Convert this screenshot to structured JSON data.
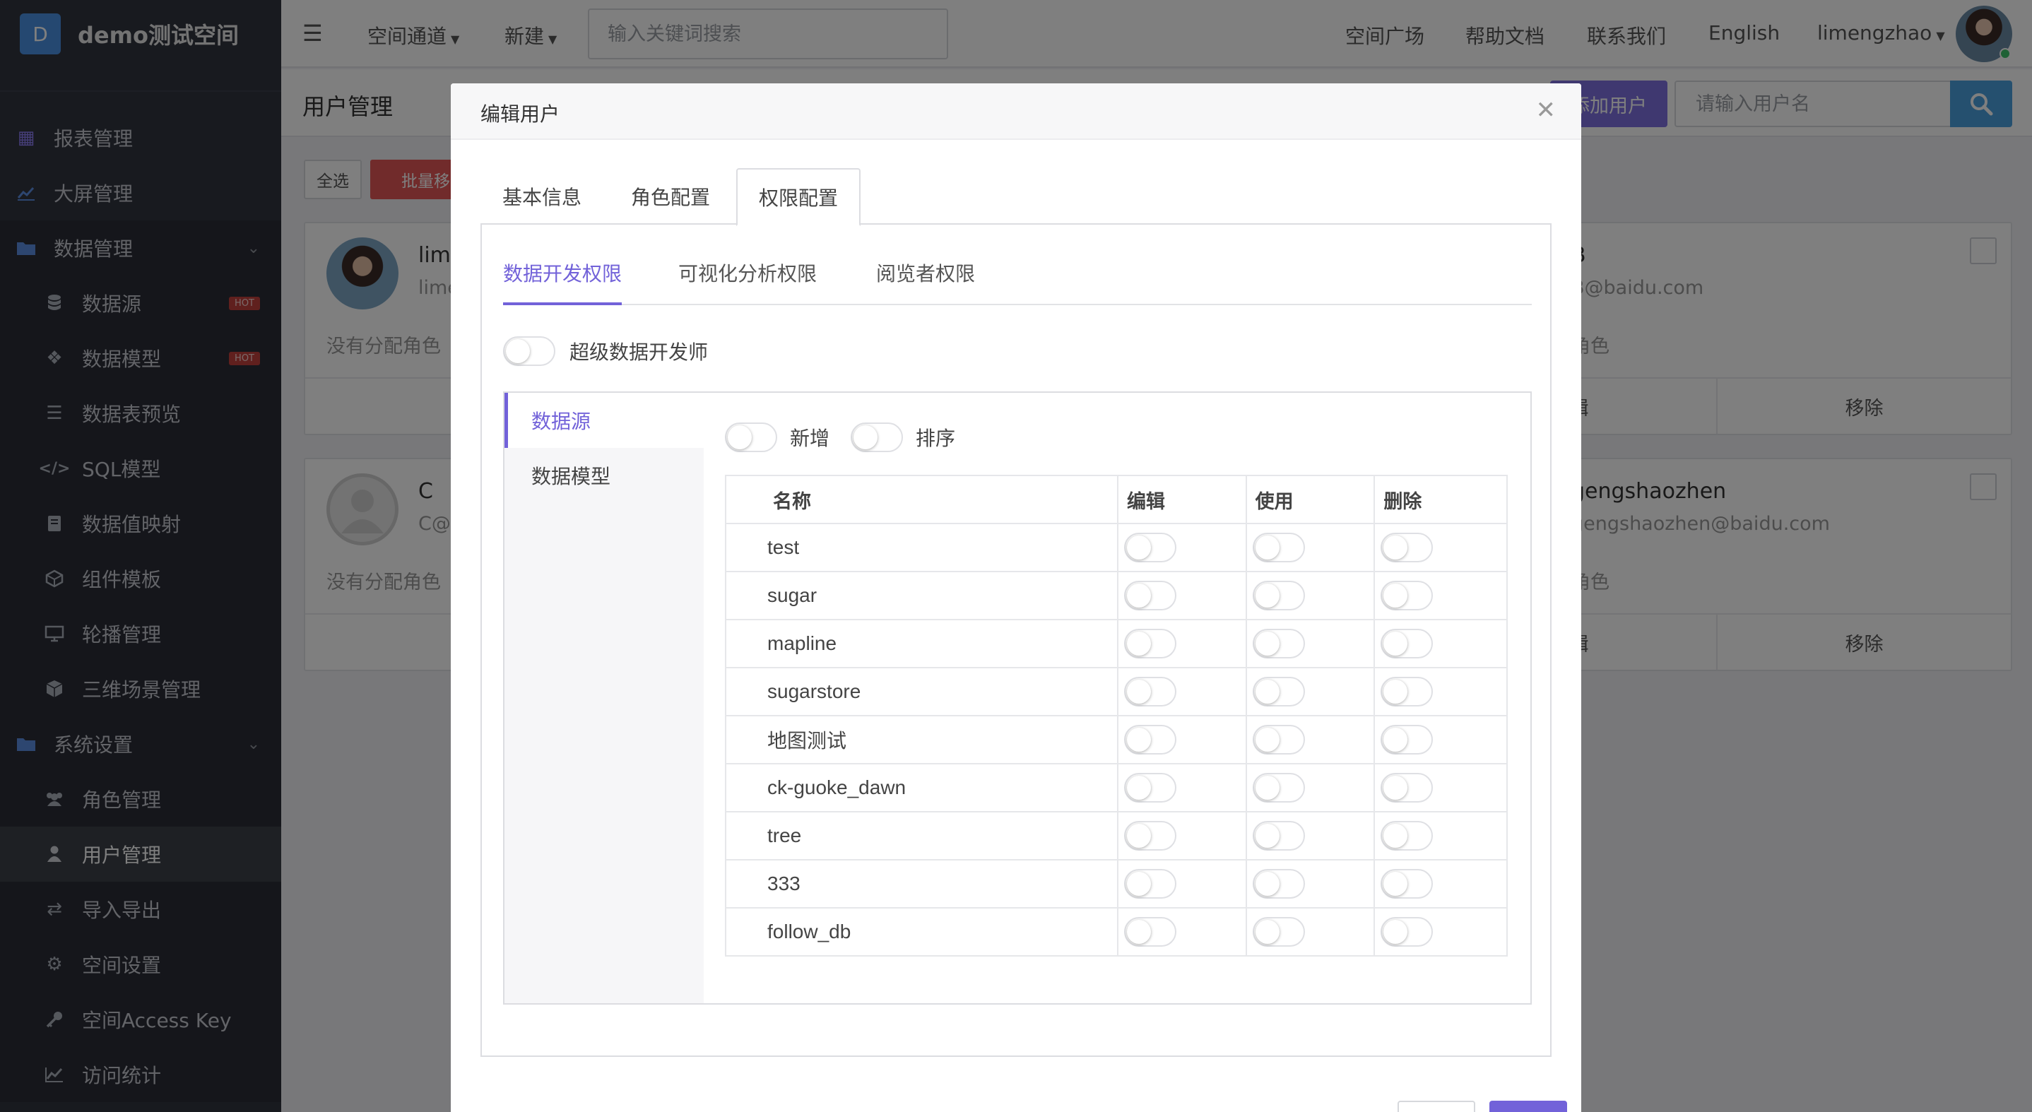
{
  "sidebar": {
    "logo_letter": "D",
    "space_name": "demo测试空间",
    "items": [
      {
        "label": "报表管理",
        "icon": "grid-icon"
      },
      {
        "label": "大屏管理",
        "icon": "line-chart-icon"
      },
      {
        "label": "数据管理",
        "icon": "folder-icon"
      },
      {
        "label": "数据源",
        "icon": "database-icon",
        "badge": "HOT"
      },
      {
        "label": "数据模型",
        "icon": "cubes-icon",
        "badge": "HOT"
      },
      {
        "label": "数据表预览",
        "icon": "list-icon"
      },
      {
        "label": "SQL模型",
        "icon": "code-icon"
      },
      {
        "label": "数据值映射",
        "icon": "book-icon"
      },
      {
        "label": "组件模板",
        "icon": "component-icon"
      },
      {
        "label": "轮播管理",
        "icon": "monitor-icon"
      },
      {
        "label": "三维场景管理",
        "icon": "cube-icon"
      },
      {
        "label": "系统设置",
        "icon": "folder-icon"
      },
      {
        "label": "角色管理",
        "icon": "users-icon"
      },
      {
        "label": "用户管理",
        "icon": "user-icon"
      },
      {
        "label": "导入导出",
        "icon": "exchange-icon"
      },
      {
        "label": "空间设置",
        "icon": "gear-icon"
      },
      {
        "label": "空间Access Key",
        "icon": "key-icon"
      },
      {
        "label": "访问统计",
        "icon": "area-chart-icon"
      }
    ]
  },
  "topbar": {
    "space_channel": "空间通道",
    "new": "新建",
    "search_placeholder": "输入关键词搜索",
    "links": [
      "空间广场",
      "帮助文档",
      "联系我们",
      "English"
    ],
    "username": "limengzhao"
  },
  "content": {
    "title": "用户管理",
    "add_user": "添加用户",
    "user_search_placeholder": "请输入用户名",
    "select_all": "全选",
    "batch_remove": "批量移除",
    "edit": "编辑",
    "remove": "移除",
    "cards": [
      {
        "name": "lime",
        "email": "lime",
        "role": "没有分配角色"
      },
      {
        "name": "B",
        "email": "B@baidu.com",
        "role": "角色"
      },
      {
        "name": "C",
        "email": "C@",
        "role": "没有分配角色"
      },
      {
        "name": "gengshaozhen",
        "email": "gengshaozhen@baidu.com",
        "role": "角色"
      }
    ]
  },
  "modal": {
    "title": "编辑用户",
    "tabs": [
      "基本信息",
      "角色配置",
      "权限配置"
    ],
    "sub_tabs": [
      "数据开发权限",
      "可视化分析权限",
      "阅览者权限"
    ],
    "super_label": "超级数据开发师",
    "nav": [
      "数据源",
      "数据模型"
    ],
    "toggle_labels": [
      "新增",
      "排序"
    ],
    "columns": [
      "名称",
      "编辑",
      "使用",
      "删除"
    ],
    "rows": [
      "test",
      "sugar",
      "mapline",
      "sugarstore",
      "地图测试",
      "ck-guoke_dawn",
      "tree",
      "333",
      "follow_db"
    ]
  }
}
